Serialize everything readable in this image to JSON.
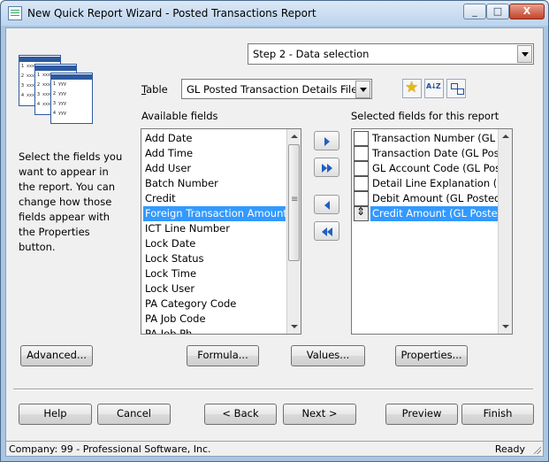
{
  "window": {
    "title": "New Quick Report Wizard - Posted Transactions Report",
    "controls": {
      "minimize": "_",
      "maximize": "□",
      "close": "X"
    }
  },
  "step": {
    "selected": "Step 2 - Data selection"
  },
  "instructions": "Select the fields you want to appear in the report. You can change how those fields appear with the Properties button.",
  "table": {
    "label_prefix": "",
    "label_mnemonic": "T",
    "label_rest": "able",
    "selected": "GL Posted Transaction Details File"
  },
  "available_fields": {
    "label": "Available fields",
    "items": [
      "Add Date",
      "Add Time",
      "Add User",
      "Batch Number",
      "Credit",
      "Foreign Transaction Amount",
      "ICT Line Number",
      "Lock Date",
      "Lock Status",
      "Lock Time",
      "Lock User",
      "PA Category Code",
      "PA Job Code",
      "PA Job Ph..."
    ],
    "selected_index": 5
  },
  "selected_fields": {
    "label": "Selected fields for this report",
    "items": [
      "Transaction Number (GL Po",
      "Transaction Date (GL Poste",
      "GL Account Code (GL Poste",
      "Detail Line Explanation (GL",
      "Debit Amount (GL Posted T",
      "Credit Amount (GL Posted"
    ],
    "selected_index": 5
  },
  "buttons": {
    "advanced": "Advanced...",
    "formula": "Formula...",
    "values": "Values...",
    "properties": "Properties...",
    "help": "Help",
    "cancel": "Cancel",
    "back": "< Back",
    "next": "Next >",
    "preview": "Preview",
    "finish": "Finish"
  },
  "status": {
    "company": "Company: 99 - Professional Software, Inc.",
    "state": "Ready"
  },
  "icons": [
    "wizard-art-icon",
    "favorite-star-icon",
    "sort-az-icon",
    "tree-structure-icon"
  ]
}
